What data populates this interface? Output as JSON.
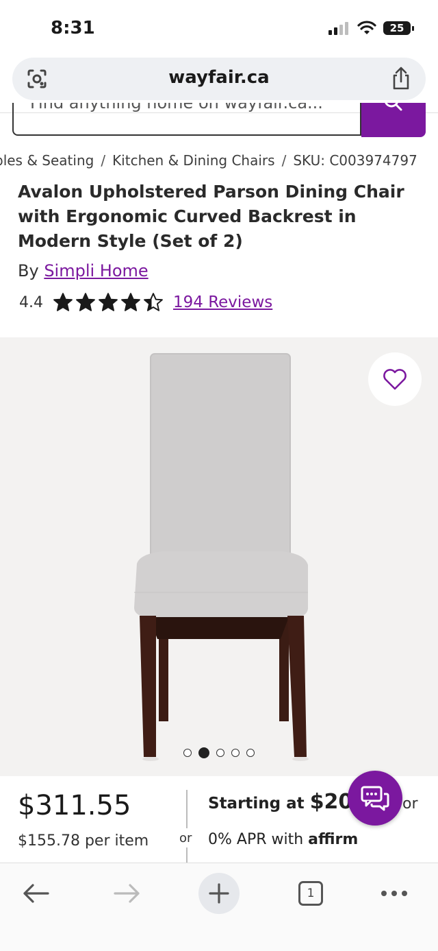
{
  "status": {
    "time": "8:31",
    "battery": "25"
  },
  "browser": {
    "url": "wayfair.ca",
    "tab_count": "1"
  },
  "search": {
    "placeholder": "Find anything home on wayfair.ca..."
  },
  "breadcrumb": {
    "items": [
      "bles & Seating",
      "Kitchen & Dining Chairs",
      "SKU: C003974797"
    ],
    "separator": "/"
  },
  "product": {
    "title": "Avalon Upholstered Parson Dining Chair with Ergonomic Curved Backrest in Modern Style (Set of 2)",
    "brand_prefix": "By",
    "brand": "Simpli Home",
    "rating_value": "4.4",
    "rating_stars": 4.4,
    "reviews": "194 Reviews",
    "price": "$311.55",
    "per_item": "$155.78 per item",
    "or_label": "or",
    "financing_prefix": "Starting at",
    "financing_amount": "$20.",
    "financing_or": "or",
    "apr_text": "0% APR with",
    "affirm": "affirm"
  },
  "gallery": {
    "image_count": 5,
    "active_index": 1
  },
  "colors": {
    "accent": "#7b189f",
    "gallery_bg": "#f3f2f1"
  },
  "icons": {
    "lens": "google-lens-icon",
    "share": "share-icon",
    "search": "search-icon",
    "favorite": "heart-icon",
    "chat": "chat-icon",
    "back": "back-arrow-icon",
    "forward": "forward-arrow-icon",
    "new_tab": "plus-icon",
    "tabs": "tab-count-icon",
    "more": "more-icon"
  }
}
